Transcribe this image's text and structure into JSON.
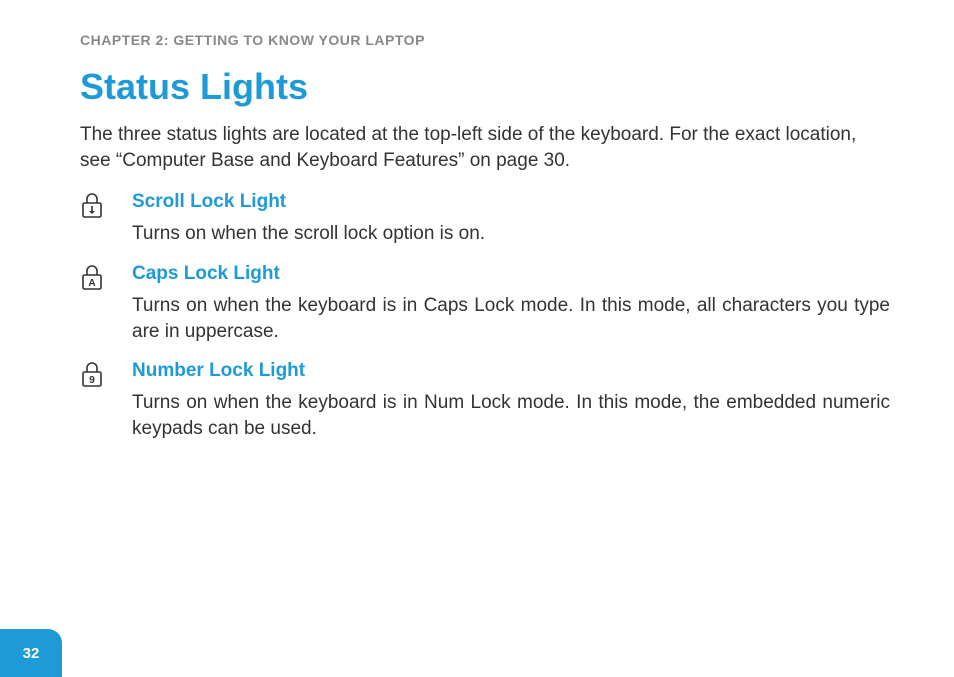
{
  "chapter_label": "CHAPTER 2: GETTING TO KNOW YOUR LAPTOP",
  "title": "Status Lights",
  "intro": "The three status lights are located at the top-left side of the keyboard. For the exact location, see “Computer Base and Keyboard Features” on page 30.",
  "items": [
    {
      "icon": "scroll-lock",
      "title": "Scroll Lock Light",
      "desc": "Turns on when the scroll lock option is on."
    },
    {
      "icon": "caps-lock",
      "title": "Caps Lock Light",
      "desc": "Turns on when the keyboard is in Caps Lock mode. In this mode, all characters you type are in uppercase."
    },
    {
      "icon": "num-lock",
      "title": "Number Lock Light",
      "desc": "Turns on when the keyboard is in Num Lock mode. In this mode, the embedded numeric keypads can be used."
    }
  ],
  "page_number": "32"
}
